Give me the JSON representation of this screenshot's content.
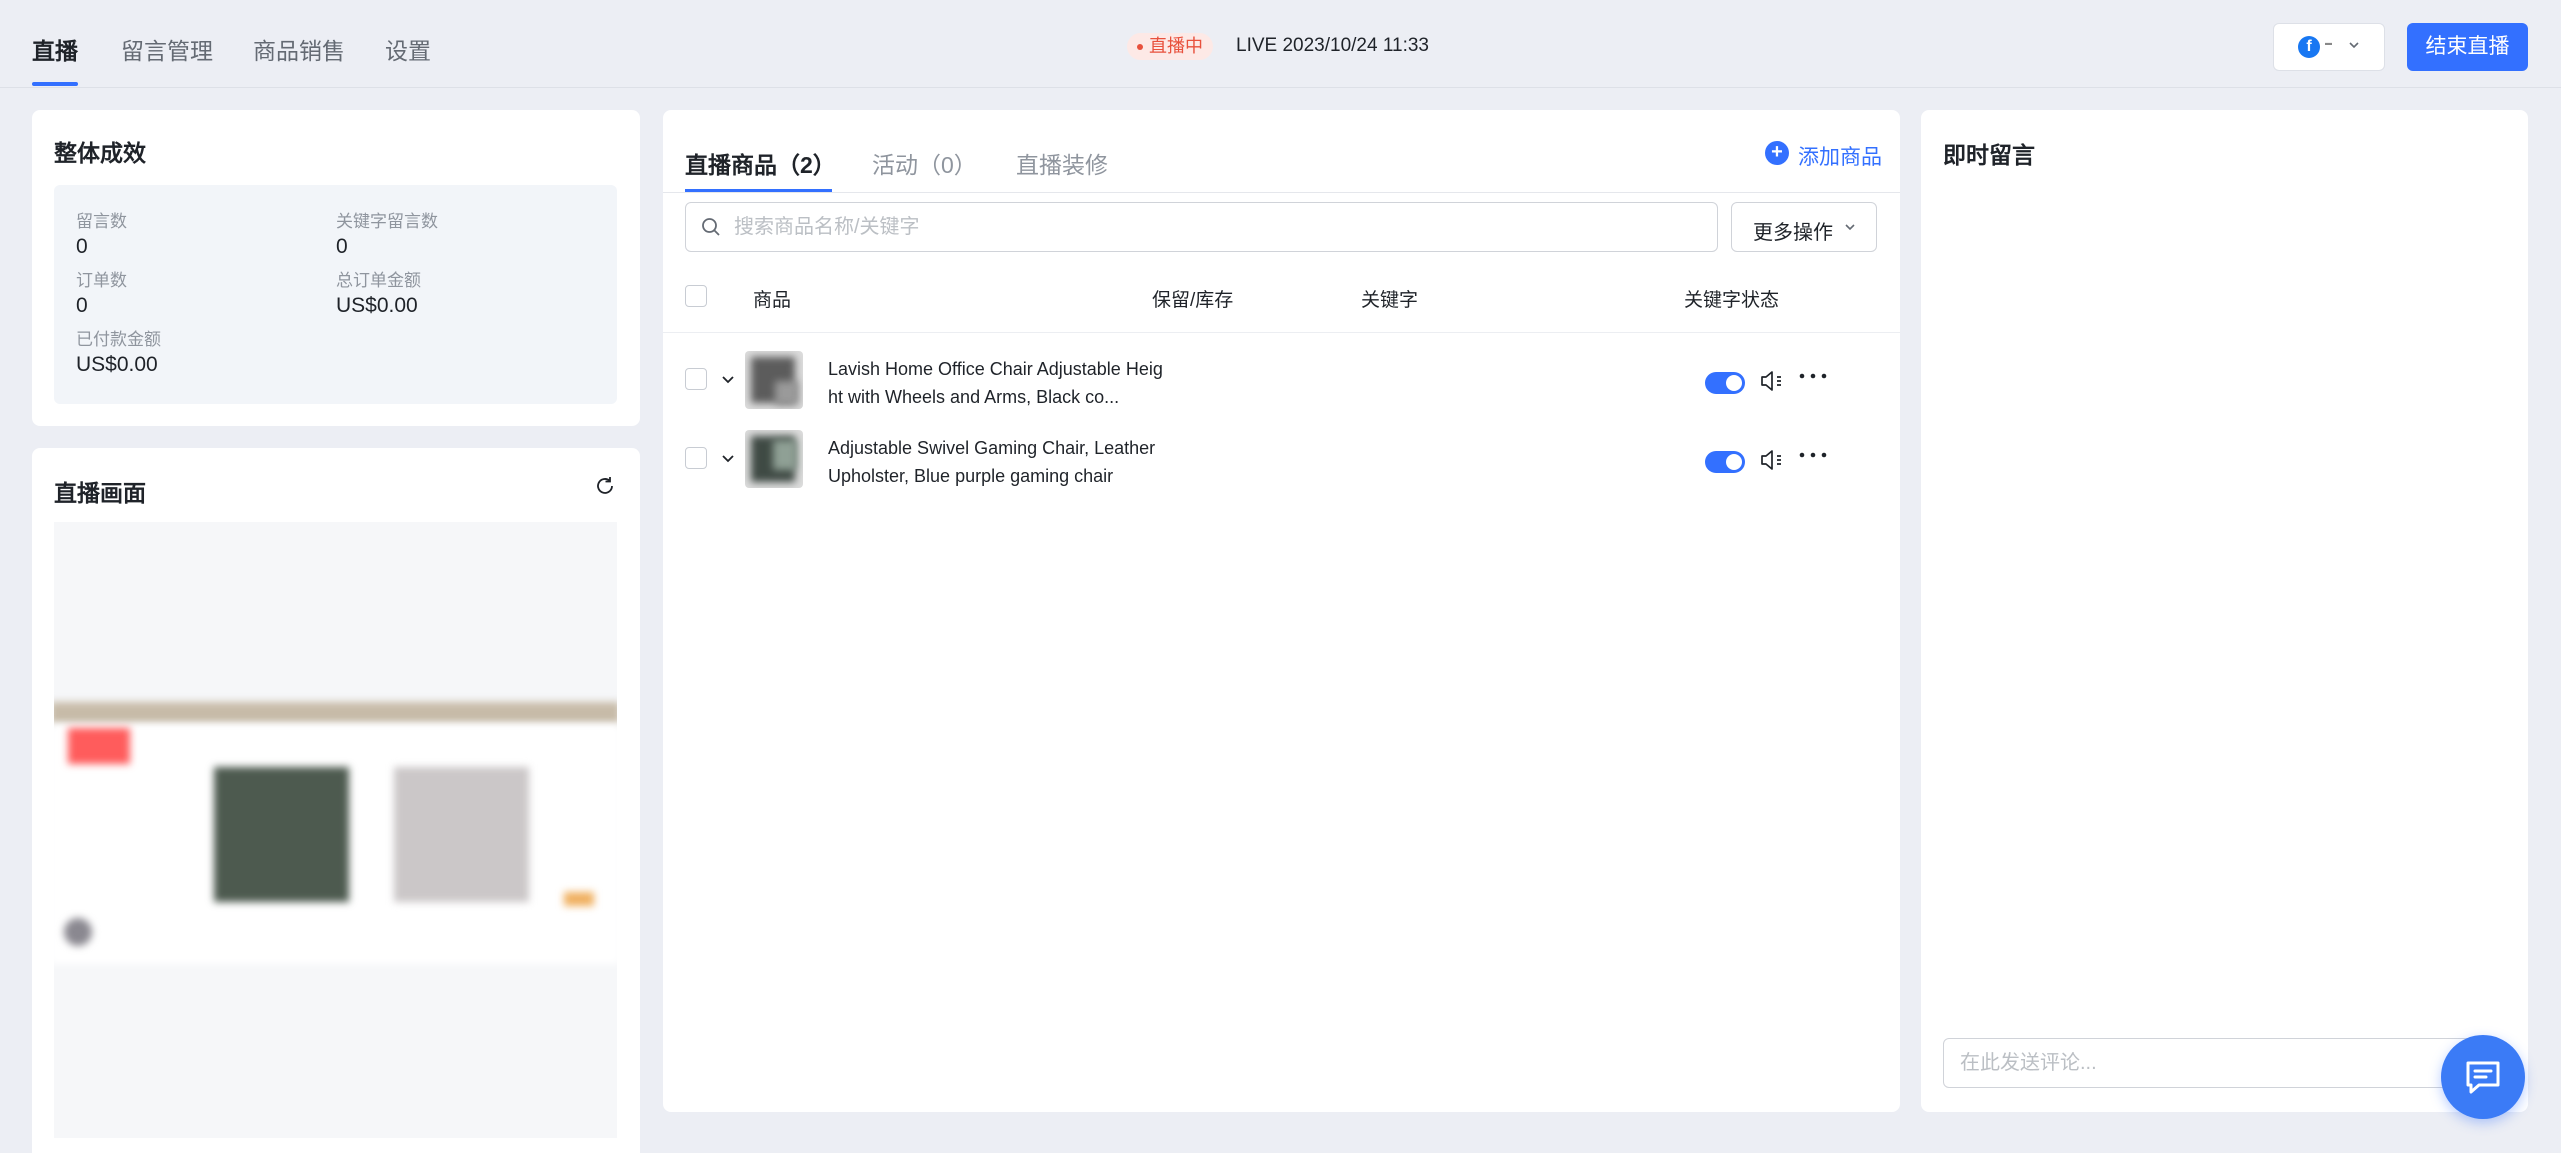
{
  "nav": {
    "tabs": [
      {
        "label": "直播"
      },
      {
        "label": "留言管理"
      },
      {
        "label": "商品销售"
      },
      {
        "label": "设置"
      }
    ]
  },
  "live": {
    "badge": "直播中",
    "time": "LIVE 2023/10/24 11:33",
    "end_button": "结束直播",
    "account_icon": "facebook-icon"
  },
  "overview": {
    "title": "整体成效",
    "stats": [
      {
        "label": "留言数",
        "value": "0"
      },
      {
        "label": "关键字留言数",
        "value": "0"
      },
      {
        "label": "订单数",
        "value": "0"
      },
      {
        "label": "总订单金额",
        "value": "US$0.00"
      },
      {
        "label": "已付款金额",
        "value": "US$0.00"
      }
    ]
  },
  "stream": {
    "title": "直播画面"
  },
  "products": {
    "tabs": [
      {
        "label": "直播商品（2）"
      },
      {
        "label": "活动（0）"
      },
      {
        "label": "直播装修"
      }
    ],
    "add_button": "添加商品",
    "search_placeholder": "搜索商品名称/关键字",
    "more_actions": "更多操作",
    "columns": [
      "商品",
      "保留/库存",
      "关键字",
      "关键字状态"
    ],
    "rows": [
      {
        "name": "Lavish Home Office Chair Adjustable Height with Wheels and Arms, Black co...",
        "keyword_enabled": true
      },
      {
        "name": "Adjustable Swivel Gaming Chair, Leather Upholster, Blue purple gaming chair",
        "keyword_enabled": true
      }
    ]
  },
  "comments": {
    "title": "即时留言",
    "input_placeholder": "在此发送评论..."
  },
  "colors": {
    "accent": "#3370ff",
    "live_red": "#e8513d",
    "background": "#eceef4"
  }
}
